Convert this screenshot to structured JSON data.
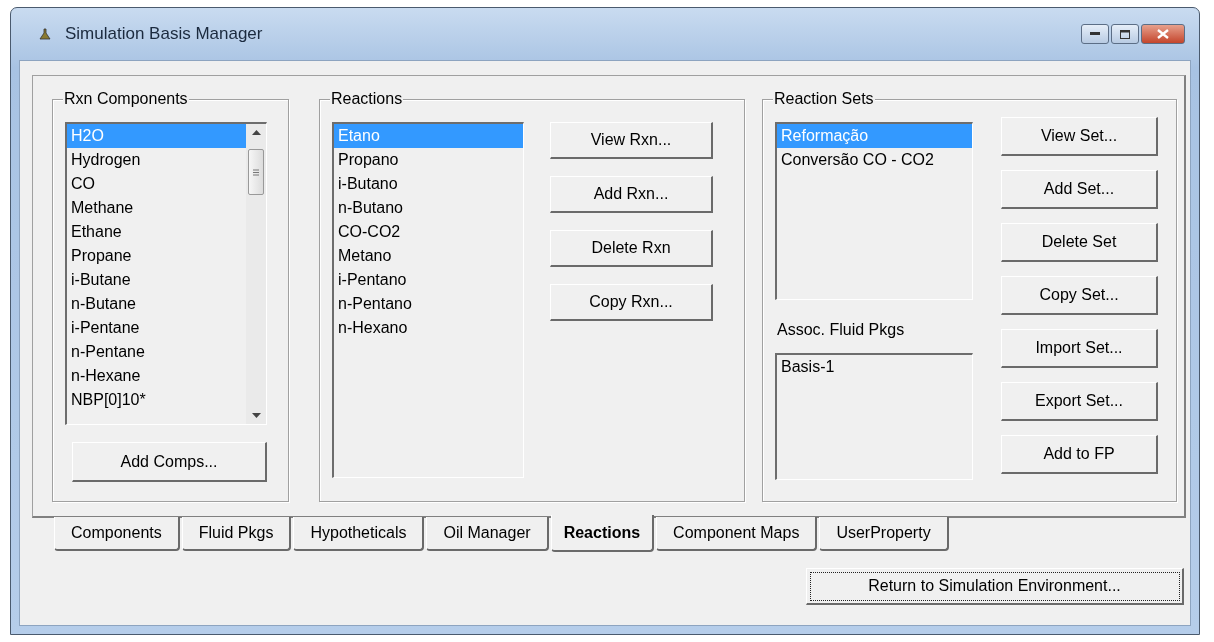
{
  "window": {
    "title": "Simulation Basis Manager"
  },
  "rxn_components": {
    "title": "Rxn Components",
    "items": [
      {
        "label": "H2O",
        "selected": true
      },
      {
        "label": "Hydrogen",
        "selected": false
      },
      {
        "label": "CO",
        "selected": false
      },
      {
        "label": "Methane",
        "selected": false
      },
      {
        "label": "Ethane",
        "selected": false
      },
      {
        "label": "Propane",
        "selected": false
      },
      {
        "label": "i-Butane",
        "selected": false
      },
      {
        "label": "n-Butane",
        "selected": false
      },
      {
        "label": "i-Pentane",
        "selected": false
      },
      {
        "label": "n-Pentane",
        "selected": false
      },
      {
        "label": "n-Hexane",
        "selected": false
      },
      {
        "label": "NBP[0]10*",
        "selected": false
      }
    ],
    "button": "Add Comps..."
  },
  "reactions": {
    "title": "Reactions",
    "items": [
      {
        "label": "Etano",
        "selected": true
      },
      {
        "label": "Propano",
        "selected": false
      },
      {
        "label": "i-Butano",
        "selected": false
      },
      {
        "label": "n-Butano",
        "selected": false
      },
      {
        "label": "CO-CO2",
        "selected": false
      },
      {
        "label": "Metano",
        "selected": false
      },
      {
        "label": "i-Pentano",
        "selected": false
      },
      {
        "label": "n-Pentano",
        "selected": false
      },
      {
        "label": "n-Hexano",
        "selected": false
      }
    ],
    "buttons": [
      "View Rxn...",
      "Add Rxn...",
      "Delete Rxn",
      "Copy Rxn..."
    ]
  },
  "reaction_sets": {
    "title": "Reaction Sets",
    "items": [
      {
        "label": "Reformação",
        "selected": true
      },
      {
        "label": "Conversão CO - CO2",
        "selected": false
      }
    ],
    "assoc_label": "Assoc. Fluid Pkgs",
    "fluid_pkgs": [
      {
        "label": "Basis-1",
        "selected": false
      }
    ],
    "buttons": [
      "View Set...",
      "Add Set...",
      "Delete Set",
      "Copy Set...",
      "Import Set...",
      "Export Set...",
      "Add to FP"
    ]
  },
  "tabs": [
    {
      "label": "Components",
      "selected": false
    },
    {
      "label": "Fluid Pkgs",
      "selected": false
    },
    {
      "label": "Hypotheticals",
      "selected": false
    },
    {
      "label": "Oil Manager",
      "selected": false
    },
    {
      "label": "Reactions",
      "selected": true
    },
    {
      "label": "Component Maps",
      "selected": false
    },
    {
      "label": "UserProperty",
      "selected": false
    }
  ],
  "return_button": {
    "label": "Return to Simulation Environment...",
    "focused": true
  }
}
